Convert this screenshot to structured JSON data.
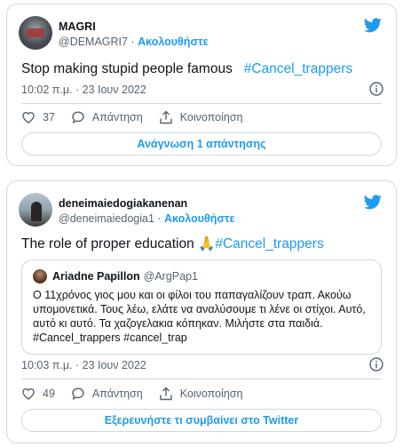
{
  "tweet1": {
    "display_name": "MAGRI",
    "handle": "@DEMAGRI7",
    "separator": "·",
    "follow_label": "Ακολουθήστε",
    "text": "Stop making stupid people famous",
    "hashtag": "#Cancel_trappers",
    "timestamp": "10:02 π.μ. · 23 Ιουν 2022",
    "likes": "37",
    "reply_label": "Απάντηση",
    "share_label": "Κοινοποίηση",
    "cta_label": "Ανάγνωση 1 απάντησης"
  },
  "tweet2": {
    "display_name": "deneimaiedogiakanenan",
    "handle": "@deneimaiedogia1",
    "separator": "·",
    "follow_label": "Ακολουθήστε",
    "text": "The role of proper education",
    "emoji": "🙏",
    "hashtag": "#Cancel_trappers",
    "quote": {
      "display_name": "Ariadne Papillon",
      "handle": "@ArgPap1",
      "line1": "Ο 11χρόνος γιος μου και οι φίλοι του παπαγαλίζουν τραπ. Ακούω",
      "line2": "υπομονετικά. Τους λέω, ελάτε να αναλύσουμε τι λένε οι στίχοι. Αυτό,",
      "line3": "αυτό κι αυτό. Τα χαζογελακια κόπηκαν. Μιλήστε στα παιδιά.",
      "line4": "#Cancel_trappers #cancel_trap"
    },
    "timestamp": "10:03 π.μ. · 23 Ιουν 2022",
    "likes": "49",
    "reply_label": "Απάντηση",
    "share_label": "Κοινοποίηση",
    "cta_label": "Εξερευνήστε τι συμβαίνει στο Twitter"
  },
  "colors": {
    "accent": "#1d9bf0",
    "muted": "#536471",
    "border": "#cfd9de",
    "text": "#0f1419"
  },
  "icons": [
    "twitter-bird-icon",
    "info-icon",
    "heart-icon",
    "reply-icon",
    "share-icon"
  ]
}
